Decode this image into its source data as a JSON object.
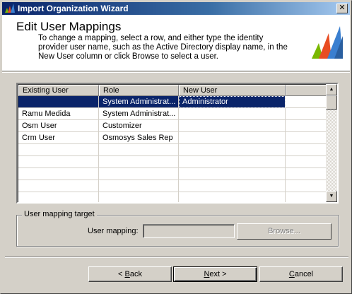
{
  "window": {
    "title": "Import Organization Wizard",
    "close_glyph": "✕"
  },
  "header": {
    "title": "Edit User Mappings",
    "description": "To change a mapping, select a row, and either type the identity provider user name, such as the Active Directory display name, in the New User column or click Browse to select a user."
  },
  "table": {
    "columns": [
      "Existing User",
      "Role",
      "New User",
      ""
    ],
    "rows": [
      {
        "existing_user": "",
        "role": "System Administrat...",
        "new_user": "Administrator",
        "selected": true
      },
      {
        "existing_user": "Ramu Medida",
        "role": "System Administrat...",
        "new_user": ""
      },
      {
        "existing_user": "Osm User",
        "role": "Customizer",
        "new_user": ""
      },
      {
        "existing_user": "Crm User",
        "role": "Osmosys Sales Rep",
        "new_user": ""
      },
      {
        "existing_user": "",
        "role": "",
        "new_user": ""
      },
      {
        "existing_user": "",
        "role": "",
        "new_user": ""
      },
      {
        "existing_user": "",
        "role": "",
        "new_user": ""
      },
      {
        "existing_user": "",
        "role": "",
        "new_user": ""
      },
      {
        "existing_user": "",
        "role": "",
        "new_user": ""
      }
    ]
  },
  "mapping_group": {
    "label": "User mapping target",
    "field_label": "User mapping:",
    "field_value": "",
    "browse_label": "Browse..."
  },
  "buttons": {
    "back_prefix": "< ",
    "back_accel": "B",
    "back_rest": "ack",
    "next_accel": "N",
    "next_rest": "ext >",
    "cancel_accel": "C",
    "cancel_rest": "ancel"
  },
  "colors": {
    "selection": "#0a246a",
    "face": "#d4d0c8",
    "logo_green": "#7ab800",
    "logo_red": "#e84c22",
    "logo_blue": "#3a7fd0"
  },
  "icons": {
    "app": "dynamics-logo-icon",
    "scroll_up": "arrow-up-icon",
    "scroll_down": "arrow-down-icon"
  }
}
